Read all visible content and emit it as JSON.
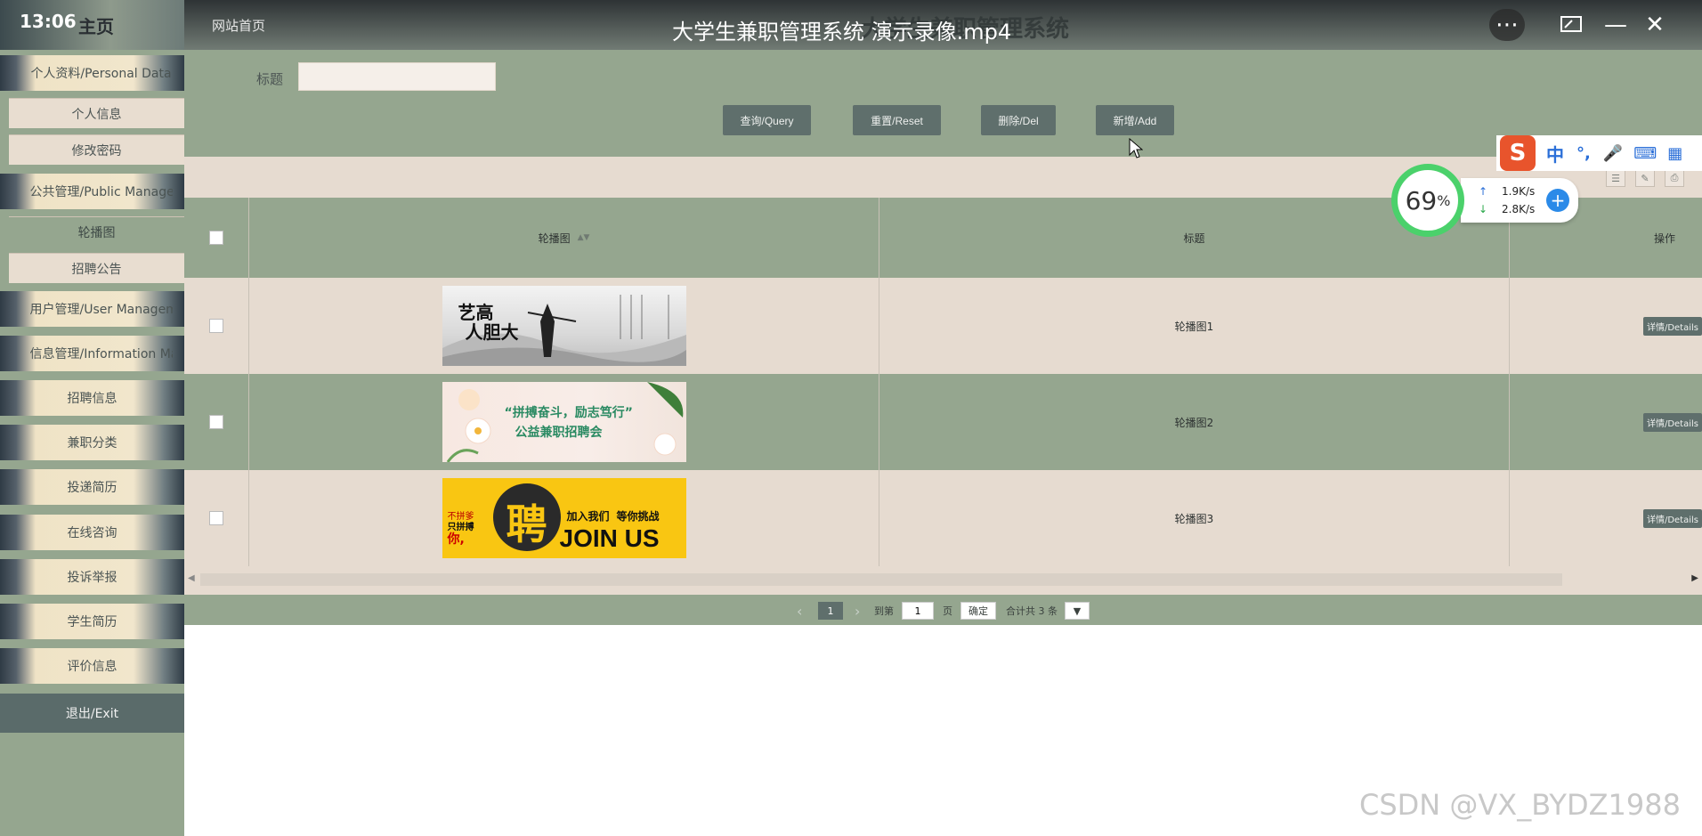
{
  "video": {
    "time": "13:06",
    "title": "大学生兼职管理系统 演示录像.mp4",
    "more_icon": "more-icon",
    "restore_icon": "restore-icon",
    "minimize_icon": "minimize-icon",
    "close_icon": "close-icon"
  },
  "app": {
    "home_label": "主页",
    "site_home": "网站首页",
    "bg_title": "大学生兼职管理系统"
  },
  "sidebar": {
    "groups": [
      {
        "label": "个人资料/Personal Data",
        "children": [
          "个人信息",
          "修改密码"
        ]
      },
      {
        "label": "公共管理/Public Management",
        "children": [
          "轮播图",
          "招聘公告"
        ]
      },
      {
        "label": "用户管理/User Management"
      },
      {
        "label": "信息管理/Information Management"
      }
    ],
    "items": [
      "招聘信息",
      "兼职分类",
      "投递简历",
      "在线咨询",
      "投诉举报",
      "学生简历",
      "评价信息"
    ],
    "exit": "退出/Exit"
  },
  "search": {
    "title_label": "标题",
    "title_value": ""
  },
  "toolbar": {
    "query": "查询/Query",
    "reset": "重置/Reset",
    "delete": "删除/Del",
    "add": "新增/Add"
  },
  "table": {
    "headers": {
      "carousel": "轮播图",
      "title": "标题",
      "actions": "操作"
    },
    "rows": [
      {
        "title": "轮播图1",
        "action": "详情/Details",
        "banner_text": [
          "艺高",
          "人胆大"
        ]
      },
      {
        "title": "轮播图2",
        "action": "详情/Details",
        "banner_text": [
          "“拼搏奋斗，励志笃行”",
          "公益兼职招聘会"
        ]
      },
      {
        "title": "轮播图3",
        "action": "详情/Details",
        "banner_text": [
          "不拼爹",
          "只拼搏",
          "你,",
          "加入我们",
          "等你挑战",
          "JOIN US",
          "聘"
        ]
      }
    ]
  },
  "pagination": {
    "current": "1",
    "goto_label": "到第",
    "goto_value": "1",
    "page_label": "页",
    "confirm": "确定",
    "total": "合计共 3 条"
  },
  "ime": {
    "lang": "中",
    "punct": "°,",
    "mic_icon": "mic-icon",
    "keyboard_icon": "keyboard-icon",
    "apps_icon": "apps-icon"
  },
  "speed": {
    "percent": "69",
    "percent_unit": "%",
    "up": "1.9K/s",
    "down": "2.8K/s"
  },
  "watermark": "CSDN @VX_BYDZ1988"
}
